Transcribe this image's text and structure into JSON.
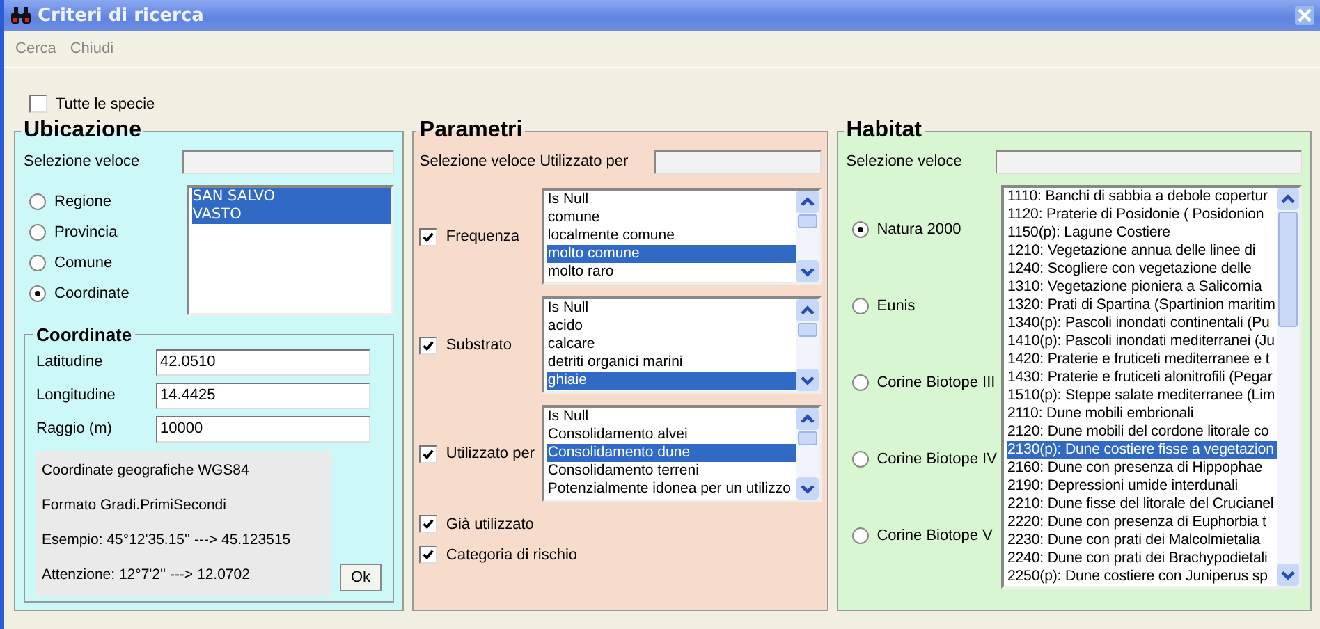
{
  "window": {
    "title": "Criteri di ricerca"
  },
  "menu": [
    {
      "label": "Cerca"
    },
    {
      "label": "Chiudi"
    }
  ],
  "all_species": {
    "label": "Tutte le specie",
    "checked": false
  },
  "ubicazione": {
    "title": "Ubicazione",
    "quick_select_label": "Selezione veloce",
    "radios": [
      {
        "label": "Regione",
        "selected": false
      },
      {
        "label": "Provincia",
        "selected": false
      },
      {
        "label": "Comune",
        "selected": false
      },
      {
        "label": "Coordinate",
        "selected": true
      }
    ],
    "items": [
      {
        "text": "SAN SALVO",
        "selected": true
      },
      {
        "text": "VASTO",
        "selected": true
      }
    ],
    "coordinate": {
      "title": "Coordinate",
      "fields": [
        {
          "label": "Latitudine",
          "value": "42.0510"
        },
        {
          "label": "Longitudine",
          "value": "14.4425"
        },
        {
          "label": "Raggio (m)",
          "value": "10000"
        }
      ],
      "notes": [
        "Coordinate geografiche WGS84",
        "Formato Gradi.PrimiSecondi",
        "Esempio: 45°12'35.15'' ---> 45.123515",
        "Attenzione: 12°7'2'' ---> 12.0702"
      ],
      "ok_button": "Ok"
    }
  },
  "parametri": {
    "title": "Parametri",
    "quick_select_label": "Selezione veloce Utilizzato per",
    "groups": [
      {
        "label": "Frequenza",
        "checked": true,
        "items": [
          {
            "text": "Is Null",
            "selected": false
          },
          {
            "text": "comune",
            "selected": false
          },
          {
            "text": "localmente comune",
            "selected": false
          },
          {
            "text": "molto comune",
            "selected": true
          },
          {
            "text": "molto raro",
            "selected": false
          }
        ]
      },
      {
        "label": "Substrato",
        "checked": true,
        "items": [
          {
            "text": "Is Null",
            "selected": false
          },
          {
            "text": "acido",
            "selected": false
          },
          {
            "text": "calcare",
            "selected": false
          },
          {
            "text": "detriti organici marini",
            "selected": false
          },
          {
            "text": "ghiaie",
            "selected": true
          }
        ]
      },
      {
        "label": "Utilizzato per",
        "checked": true,
        "items": [
          {
            "text": "Is Null",
            "selected": false
          },
          {
            "text": "Consolidamento alvei",
            "selected": false
          },
          {
            "text": "Consolidamento dune",
            "selected": true
          },
          {
            "text": "Consolidamento terreni",
            "selected": false
          },
          {
            "text": "Potenzialmente idonea per un utilizzo",
            "selected": false
          }
        ]
      }
    ],
    "checks": [
      {
        "label": "Già utilizzato",
        "checked": true
      },
      {
        "label": "Categoria di rischio",
        "checked": true
      }
    ]
  },
  "habitat": {
    "title": "Habitat",
    "quick_select_label": "Selezione veloce",
    "radios": [
      {
        "label": "Natura 2000",
        "selected": true
      },
      {
        "label": "Eunis",
        "selected": false
      },
      {
        "label": "Corine Biotope III",
        "selected": false
      },
      {
        "label": "Corine Biotope IV",
        "selected": false
      },
      {
        "label": "Corine Biotope V",
        "selected": false
      }
    ],
    "items": [
      {
        "text": "1110: Banchi di sabbia a debole copertur",
        "selected": false
      },
      {
        "text": "1120: Praterie di Posidonie ( Posidonion",
        "selected": false
      },
      {
        "text": "1150(p): Lagune Costiere",
        "selected": false
      },
      {
        "text": "1210: Vegetazione annua delle linee di",
        "selected": false
      },
      {
        "text": "1240: Scogliere con vegetazione delle",
        "selected": false
      },
      {
        "text": "1310: Vegetazione pioniera a Salicornia",
        "selected": false
      },
      {
        "text": "1320: Prati di Spartina (Spartinion maritim",
        "selected": false
      },
      {
        "text": "1340(p): Pascoli inondati continentali (Pu",
        "selected": false
      },
      {
        "text": "1410(p): Pascoli inondati mediterranei (Ju",
        "selected": false
      },
      {
        "text": "1420: Praterie e fruticeti mediterranee e t",
        "selected": false
      },
      {
        "text": "1430: Praterie e fruticeti alonitrofili (Pegar",
        "selected": false
      },
      {
        "text": "1510(p): Steppe salate mediterranee (Lim",
        "selected": false
      },
      {
        "text": "2110: Dune mobili embrionali",
        "selected": false
      },
      {
        "text": "2120: Dune mobili del cordone litorale co",
        "selected": false
      },
      {
        "text": "2130(p): Dune costiere fisse a vegetazion",
        "selected": true
      },
      {
        "text": "2160: Dune con presenza di Hippophae",
        "selected": false
      },
      {
        "text": "2190: Depressioni umide interdunali",
        "selected": false
      },
      {
        "text": "2210: Dune fisse del litorale del Crucianel",
        "selected": false
      },
      {
        "text": "2220: Dune con presenza di Euphorbia t",
        "selected": false
      },
      {
        "text": "2230: Dune con prati dei Malcolmietalia",
        "selected": false
      },
      {
        "text": "2240: Dune con prati dei Brachypodietali",
        "selected": false
      },
      {
        "text": "2250(p): Dune costiere con Juniperus sp",
        "selected": false
      }
    ]
  }
}
